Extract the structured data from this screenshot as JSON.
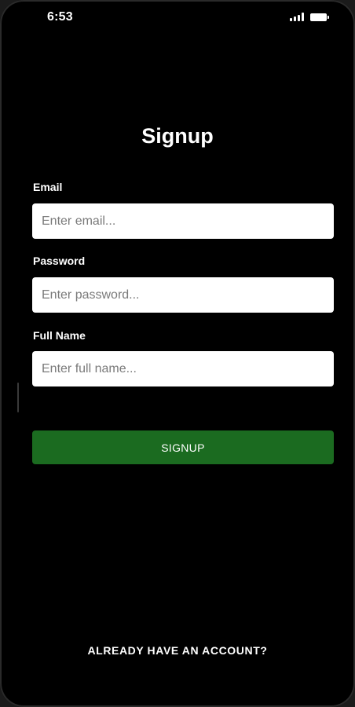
{
  "status_bar": {
    "time": "6:53",
    "icons": [
      "signal-icon",
      "battery-icon"
    ]
  },
  "page": {
    "title": "Signup"
  },
  "form": {
    "email": {
      "label": "Email",
      "placeholder": "Enter email...",
      "value": ""
    },
    "password": {
      "label": "Password",
      "placeholder": "Enter password...",
      "value": ""
    },
    "full_name": {
      "label": "Full Name",
      "placeholder": "Enter full name...",
      "value": ""
    },
    "submit_label": "SIGNUP"
  },
  "footer": {
    "login_link": "ALREADY HAVE AN ACCOUNT?"
  },
  "colors": {
    "background": "#000000",
    "button": "#1b6b20",
    "input_background": "#ffffff",
    "text": "#ffffff"
  }
}
